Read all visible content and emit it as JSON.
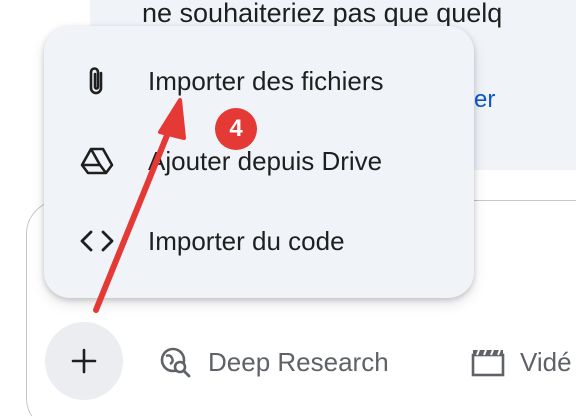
{
  "background": {
    "response_text": "ne souhaiteriez pas que quelq",
    "response_link": "er"
  },
  "menu": {
    "items": [
      {
        "label": "Importer des fichiers",
        "icon": "paperclip-icon"
      },
      {
        "label": "Ajouter depuis Drive",
        "icon": "google-drive-icon"
      },
      {
        "label": "Importer du code",
        "icon": "code-brackets-icon"
      }
    ]
  },
  "composer": {
    "plus_icon": "plus-icon",
    "tools": [
      {
        "label": "Deep Research",
        "icon": "deep-research-icon"
      },
      {
        "label": "Vidé",
        "icon": "video-clapper-icon"
      }
    ]
  },
  "annotation": {
    "step_number": "4",
    "color": "#e53935"
  },
  "colors": {
    "menu_background": "#f0f4f9",
    "text_primary": "#1f1f1f",
    "text_secondary": "#5f6368",
    "link": "#0b57d0"
  }
}
